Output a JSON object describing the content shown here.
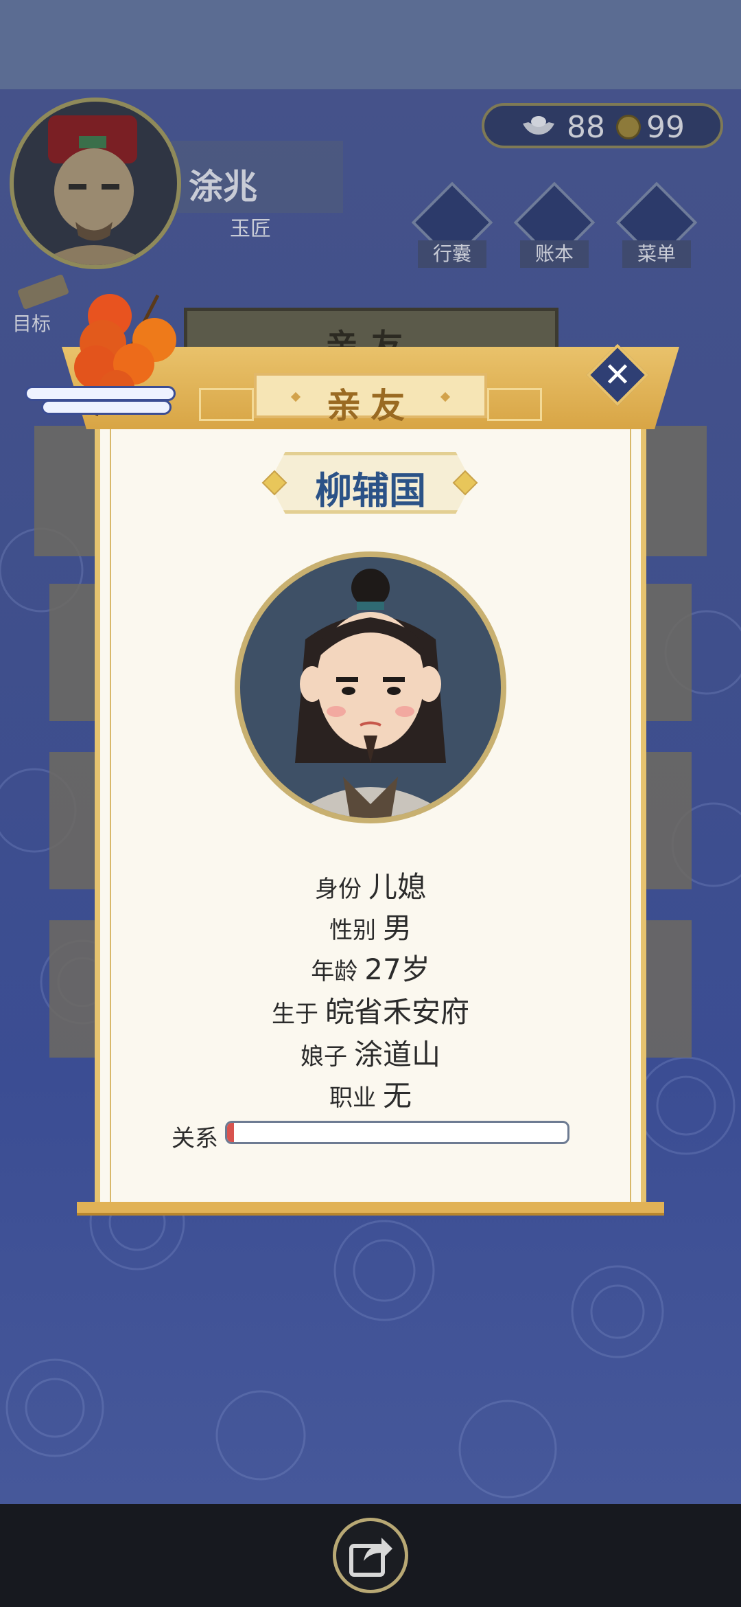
{
  "player": {
    "name": "涂兆",
    "title": "玉匠"
  },
  "currency": {
    "silver": "88",
    "copper": "99"
  },
  "menu": [
    {
      "label": "行囊",
      "icon": "bag-icon"
    },
    {
      "label": "账本",
      "icon": "ledger-icon"
    },
    {
      "label": "菜单",
      "icon": "more-icon"
    }
  ],
  "goal_label": "目标",
  "background_panel_title": "亲友",
  "dialog": {
    "title": "亲友",
    "character_name": "柳辅国",
    "info": [
      {
        "label": "身份",
        "value": "儿媳"
      },
      {
        "label": "性别",
        "value": "男"
      },
      {
        "label": "年龄",
        "value": "27岁"
      },
      {
        "label": "生于",
        "value": "皖省禾安府"
      },
      {
        "label": "娘子",
        "value": "涂道山"
      },
      {
        "label": "职业",
        "value": "无"
      }
    ],
    "relation_label": "关系",
    "relation_level": 0.02
  },
  "colors": {
    "accent_gold": "#e6c36f",
    "name_blue": "#2b5287",
    "relation_red": "#d8534e",
    "background_blue": "#3f4f8c"
  }
}
